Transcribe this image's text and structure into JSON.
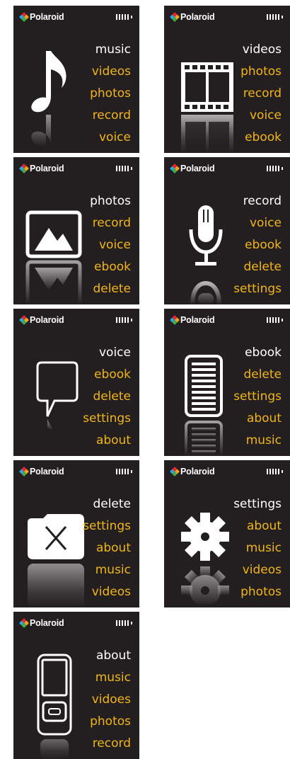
{
  "brand": {
    "name": "Polaroid"
  },
  "colors": {
    "screen_bg": "#231f20",
    "selected": "#ffffff",
    "item": "#f2b516"
  },
  "screens": [
    {
      "icon": "music-note-icon",
      "items": [
        "music",
        "videos",
        "photos",
        "record",
        "voice"
      ]
    },
    {
      "icon": "film-strip-icon",
      "items": [
        "videos",
        "photos",
        "record",
        "voice",
        "ebook"
      ]
    },
    {
      "icon": "photo-icon",
      "items": [
        "photos",
        "record",
        "voice",
        "ebook",
        "delete"
      ]
    },
    {
      "icon": "microphone-icon",
      "items": [
        "record",
        "voice",
        "ebook",
        "delete",
        "settings"
      ]
    },
    {
      "icon": "speech-bubble-icon",
      "items": [
        "voice",
        "ebook",
        "delete",
        "settings",
        "about"
      ]
    },
    {
      "icon": "ebook-icon",
      "items": [
        "ebook",
        "delete",
        "settings",
        "about",
        "music"
      ]
    },
    {
      "icon": "delete-folder-icon",
      "items": [
        "delete",
        "settings",
        "about",
        "music",
        "videos"
      ]
    },
    {
      "icon": "gear-icon",
      "items": [
        "settings",
        "about",
        "music",
        "videos",
        "photos"
      ]
    },
    {
      "icon": "player-device-icon",
      "items": [
        "about",
        "music",
        "vidoes",
        "photos",
        "record"
      ]
    }
  ]
}
